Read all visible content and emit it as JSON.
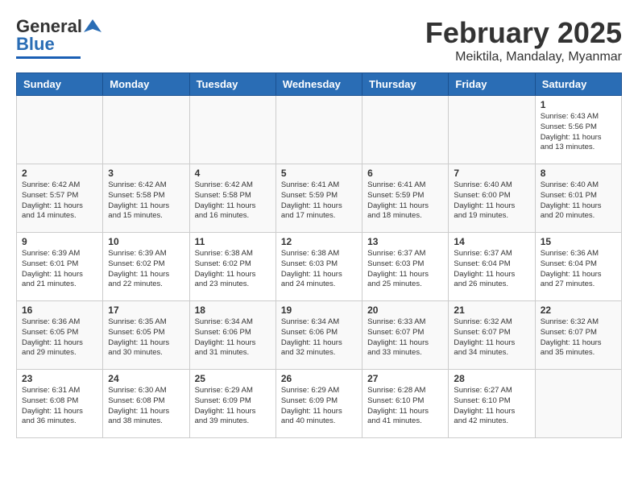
{
  "logo": {
    "line1": "General",
    "line2": "Blue"
  },
  "header": {
    "month": "February 2025",
    "location": "Meiktila, Mandalay, Myanmar"
  },
  "weekdays": [
    "Sunday",
    "Monday",
    "Tuesday",
    "Wednesday",
    "Thursday",
    "Friday",
    "Saturday"
  ],
  "weeks": [
    [
      {
        "day": "",
        "info": ""
      },
      {
        "day": "",
        "info": ""
      },
      {
        "day": "",
        "info": ""
      },
      {
        "day": "",
        "info": ""
      },
      {
        "day": "",
        "info": ""
      },
      {
        "day": "",
        "info": ""
      },
      {
        "day": "1",
        "info": "Sunrise: 6:43 AM\nSunset: 5:56 PM\nDaylight: 11 hours\nand 13 minutes."
      }
    ],
    [
      {
        "day": "2",
        "info": "Sunrise: 6:42 AM\nSunset: 5:57 PM\nDaylight: 11 hours\nand 14 minutes."
      },
      {
        "day": "3",
        "info": "Sunrise: 6:42 AM\nSunset: 5:58 PM\nDaylight: 11 hours\nand 15 minutes."
      },
      {
        "day": "4",
        "info": "Sunrise: 6:42 AM\nSunset: 5:58 PM\nDaylight: 11 hours\nand 16 minutes."
      },
      {
        "day": "5",
        "info": "Sunrise: 6:41 AM\nSunset: 5:59 PM\nDaylight: 11 hours\nand 17 minutes."
      },
      {
        "day": "6",
        "info": "Sunrise: 6:41 AM\nSunset: 5:59 PM\nDaylight: 11 hours\nand 18 minutes."
      },
      {
        "day": "7",
        "info": "Sunrise: 6:40 AM\nSunset: 6:00 PM\nDaylight: 11 hours\nand 19 minutes."
      },
      {
        "day": "8",
        "info": "Sunrise: 6:40 AM\nSunset: 6:01 PM\nDaylight: 11 hours\nand 20 minutes."
      }
    ],
    [
      {
        "day": "9",
        "info": "Sunrise: 6:39 AM\nSunset: 6:01 PM\nDaylight: 11 hours\nand 21 minutes."
      },
      {
        "day": "10",
        "info": "Sunrise: 6:39 AM\nSunset: 6:02 PM\nDaylight: 11 hours\nand 22 minutes."
      },
      {
        "day": "11",
        "info": "Sunrise: 6:38 AM\nSunset: 6:02 PM\nDaylight: 11 hours\nand 23 minutes."
      },
      {
        "day": "12",
        "info": "Sunrise: 6:38 AM\nSunset: 6:03 PM\nDaylight: 11 hours\nand 24 minutes."
      },
      {
        "day": "13",
        "info": "Sunrise: 6:37 AM\nSunset: 6:03 PM\nDaylight: 11 hours\nand 25 minutes."
      },
      {
        "day": "14",
        "info": "Sunrise: 6:37 AM\nSunset: 6:04 PM\nDaylight: 11 hours\nand 26 minutes."
      },
      {
        "day": "15",
        "info": "Sunrise: 6:36 AM\nSunset: 6:04 PM\nDaylight: 11 hours\nand 27 minutes."
      }
    ],
    [
      {
        "day": "16",
        "info": "Sunrise: 6:36 AM\nSunset: 6:05 PM\nDaylight: 11 hours\nand 29 minutes."
      },
      {
        "day": "17",
        "info": "Sunrise: 6:35 AM\nSunset: 6:05 PM\nDaylight: 11 hours\nand 30 minutes."
      },
      {
        "day": "18",
        "info": "Sunrise: 6:34 AM\nSunset: 6:06 PM\nDaylight: 11 hours\nand 31 minutes."
      },
      {
        "day": "19",
        "info": "Sunrise: 6:34 AM\nSunset: 6:06 PM\nDaylight: 11 hours\nand 32 minutes."
      },
      {
        "day": "20",
        "info": "Sunrise: 6:33 AM\nSunset: 6:07 PM\nDaylight: 11 hours\nand 33 minutes."
      },
      {
        "day": "21",
        "info": "Sunrise: 6:32 AM\nSunset: 6:07 PM\nDaylight: 11 hours\nand 34 minutes."
      },
      {
        "day": "22",
        "info": "Sunrise: 6:32 AM\nSunset: 6:07 PM\nDaylight: 11 hours\nand 35 minutes."
      }
    ],
    [
      {
        "day": "23",
        "info": "Sunrise: 6:31 AM\nSunset: 6:08 PM\nDaylight: 11 hours\nand 36 minutes."
      },
      {
        "day": "24",
        "info": "Sunrise: 6:30 AM\nSunset: 6:08 PM\nDaylight: 11 hours\nand 38 minutes."
      },
      {
        "day": "25",
        "info": "Sunrise: 6:29 AM\nSunset: 6:09 PM\nDaylight: 11 hours\nand 39 minutes."
      },
      {
        "day": "26",
        "info": "Sunrise: 6:29 AM\nSunset: 6:09 PM\nDaylight: 11 hours\nand 40 minutes."
      },
      {
        "day": "27",
        "info": "Sunrise: 6:28 AM\nSunset: 6:10 PM\nDaylight: 11 hours\nand 41 minutes."
      },
      {
        "day": "28",
        "info": "Sunrise: 6:27 AM\nSunset: 6:10 PM\nDaylight: 11 hours\nand 42 minutes."
      },
      {
        "day": "",
        "info": ""
      }
    ]
  ]
}
